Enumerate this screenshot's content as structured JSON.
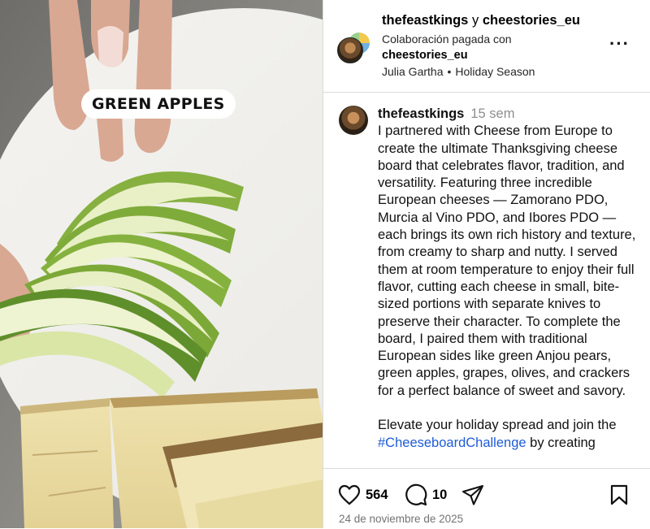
{
  "header": {
    "author": "thefeastkings",
    "conjunction": "y",
    "collaborator": "cheestories_eu",
    "paid_label": "Colaboración pagada con",
    "paid_partner": "cheestories_eu",
    "audio_artist": "Julia Gartha",
    "separator": "•",
    "audio_title": "Holiday Season",
    "more_icon": "more-options-icon"
  },
  "media": {
    "caption": "GREEN APPLES"
  },
  "post": {
    "username": "thefeastkings",
    "time_ago": "15 sem",
    "body": "I partnered with Cheese from Europe to create the ultimate Thanksgiving cheese board that celebrates flavor, tradition, and versatility. Featuring three incredible European cheeses — Zamorano PDO, Murcia al Vino PDO, and Ibores PDO — each brings its own rich history and texture, from creamy to sharp and nutty. I served them at room temperature to enjoy their full flavor, cutting each cheese in small, bite-sized portions with separate knives to preserve their character. To complete the board, I paired them with traditional European sides like green Anjou pears, green apples, grapes, olives, and crackers for a perfect balance of sweet and savory.\n\nElevate your holiday spread and join the ",
    "hashtag": "#CheeseboardChallenge",
    "body_tail": " by creating"
  },
  "actions": {
    "likes": "564",
    "comments": "10",
    "date": "24 de noviembre de 2025"
  }
}
